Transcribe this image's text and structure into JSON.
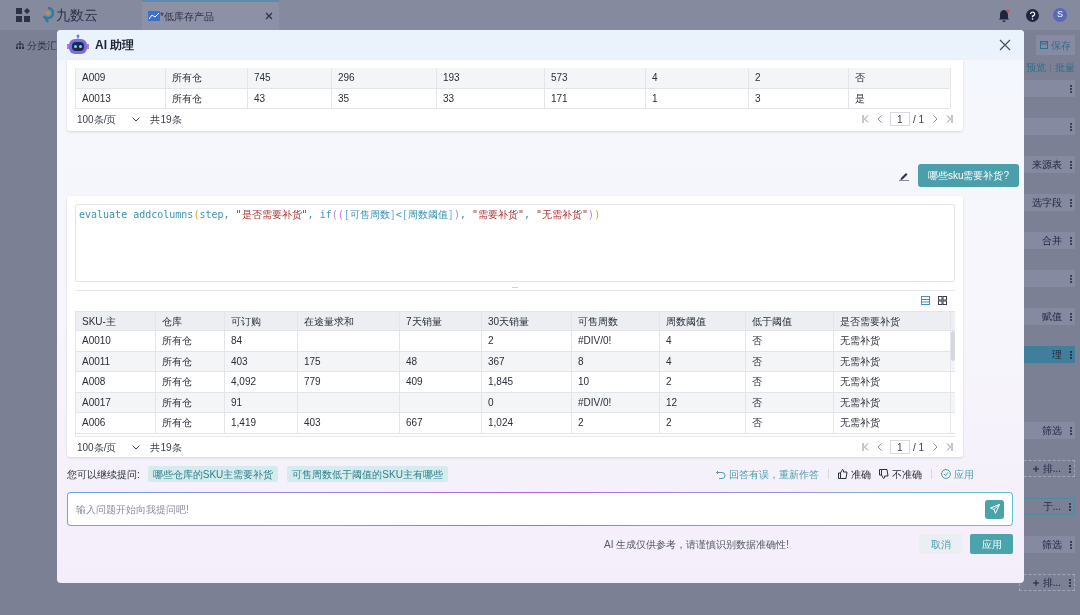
{
  "topbar": {
    "app_name": "九数云",
    "tab": {
      "label": "*低库存产品",
      "selected": true
    },
    "has_unread": true,
    "avatar": "S"
  },
  "toolbar": {
    "left_label": "分类汇",
    "save": "保存",
    "actions": [
      "预览",
      "批量"
    ]
  },
  "step_groups": [
    [
      {
        "kind": "plain",
        "selected": false
      },
      {
        "kind": "plain",
        "selected": false
      },
      {
        "kind": "plain",
        "label": "来源表",
        "selected": false
      },
      {
        "kind": "plain",
        "label": "选字段",
        "selected": false
      },
      {
        "kind": "plain",
        "label": "合并",
        "selected": false
      },
      {
        "kind": "plain",
        "selected": false
      },
      {
        "kind": "plain",
        "label": "赋值",
        "selected": false
      },
      {
        "kind": "plain",
        "label": "理",
        "selected": true
      }
    ],
    [
      {
        "kind": "plain",
        "label": "筛选",
        "selected": false
      },
      {
        "kind": "dashed",
        "label": "排...",
        "selected": false
      },
      {
        "kind": "outlined",
        "label": "于...",
        "selected": false
      },
      {
        "kind": "plain",
        "label": "筛选",
        "selected": false
      },
      {
        "kind": "dashed",
        "label": "排...",
        "selected": false
      }
    ]
  ],
  "modal": {
    "title": "AI 助理",
    "history_table": {
      "rows": [
        [
          "A009",
          "所有仓",
          "745",
          "296",
          "193",
          "573",
          "4",
          "2",
          "否"
        ],
        [
          "A0013",
          "所有仓",
          "43",
          "35",
          "33",
          "171",
          "1",
          "3",
          "是"
        ]
      ],
      "pagination": {
        "page_size": "100条/页",
        "total": "共19条",
        "page": "1",
        "pages": "/ 1"
      }
    },
    "question": "哪些sku需要补货?",
    "answer": {
      "code": [
        {
          "kind": "ident",
          "text": "evaluate addcolumns"
        },
        {
          "kind": "paren1",
          "text": "("
        },
        {
          "kind": "ident",
          "text": "step, "
        },
        {
          "kind": "string",
          "text": "\"是否需要补货\""
        },
        {
          "kind": "ident",
          "text": ", if"
        },
        {
          "kind": "paren2",
          "text": "(("
        },
        {
          "kind": "bracket",
          "text": "["
        },
        {
          "kind": "ident",
          "text": "可售周数"
        },
        {
          "kind": "bracket",
          "text": "]"
        },
        {
          "kind": "ident",
          "text": "<"
        },
        {
          "kind": "bracket",
          "text": "["
        },
        {
          "kind": "ident",
          "text": "周数阈值"
        },
        {
          "kind": "bracket",
          "text": "]"
        },
        {
          "kind": "paren2",
          "text": ")"
        },
        {
          "kind": "ident",
          "text": ", "
        },
        {
          "kind": "string",
          "text": "\"需要补货\""
        },
        {
          "kind": "ident",
          "text": ", "
        },
        {
          "kind": "string",
          "text": "\"无需补货\""
        },
        {
          "kind": "paren2",
          "text": ")"
        },
        {
          "kind": "paren1",
          "text": ")"
        }
      ],
      "handle": "...",
      "table": {
        "columns": [
          "SKU-主",
          "仓库",
          "可订购",
          "在途量求和",
          "7天销量",
          "30天销量",
          "可售周数",
          "周数阈值",
          "低于阈值",
          "是否需要补货"
        ],
        "rows": [
          [
            "A0010",
            "所有仓",
            "84",
            null,
            null,
            "2",
            "#DIV/0!",
            "4",
            "否",
            "无需补货"
          ],
          [
            "A0011",
            "所有仓",
            "403",
            "175",
            "48",
            "367",
            "8",
            "4",
            "否",
            "无需补货"
          ],
          [
            "A008",
            "所有仓",
            "4,092",
            "779",
            "409",
            "1,845",
            "10",
            "2",
            "否",
            "无需补货"
          ],
          [
            "A0017",
            "所有仓",
            "91",
            null,
            null,
            "0",
            "#DIV/0!",
            "12",
            "否",
            "无需补货"
          ],
          [
            "A006",
            "所有仓",
            "1,419",
            "403",
            "667",
            "1,024",
            "2",
            "2",
            "否",
            "无需补货"
          ]
        ]
      },
      "pagination": {
        "page_size": "100条/页",
        "total": "共19条",
        "page": "1",
        "pages": "/ 1"
      }
    },
    "suggestions": {
      "label": "您可以继续提问:",
      "items": [
        "哪些仓库的SKU主需要补货",
        "可售周数低于阈值的SKU主有哪些"
      ]
    },
    "feedback": [
      {
        "kind": "retry",
        "label": "回答有误，重新作答"
      },
      {
        "kind": "like",
        "label": "准确"
      },
      {
        "kind": "dislike",
        "label": "不准确"
      },
      {
        "kind": "apply",
        "label": "应用"
      }
    ],
    "input": {
      "placeholder": "输入问题开始向我提问吧!"
    },
    "disclaimer": "AI 生成仅供参考，请谨慎识别数据准确性!",
    "buttons": [
      {
        "kind": "secondary",
        "label": "取消"
      },
      {
        "kind": "primary",
        "label": "应用"
      }
    ]
  }
}
